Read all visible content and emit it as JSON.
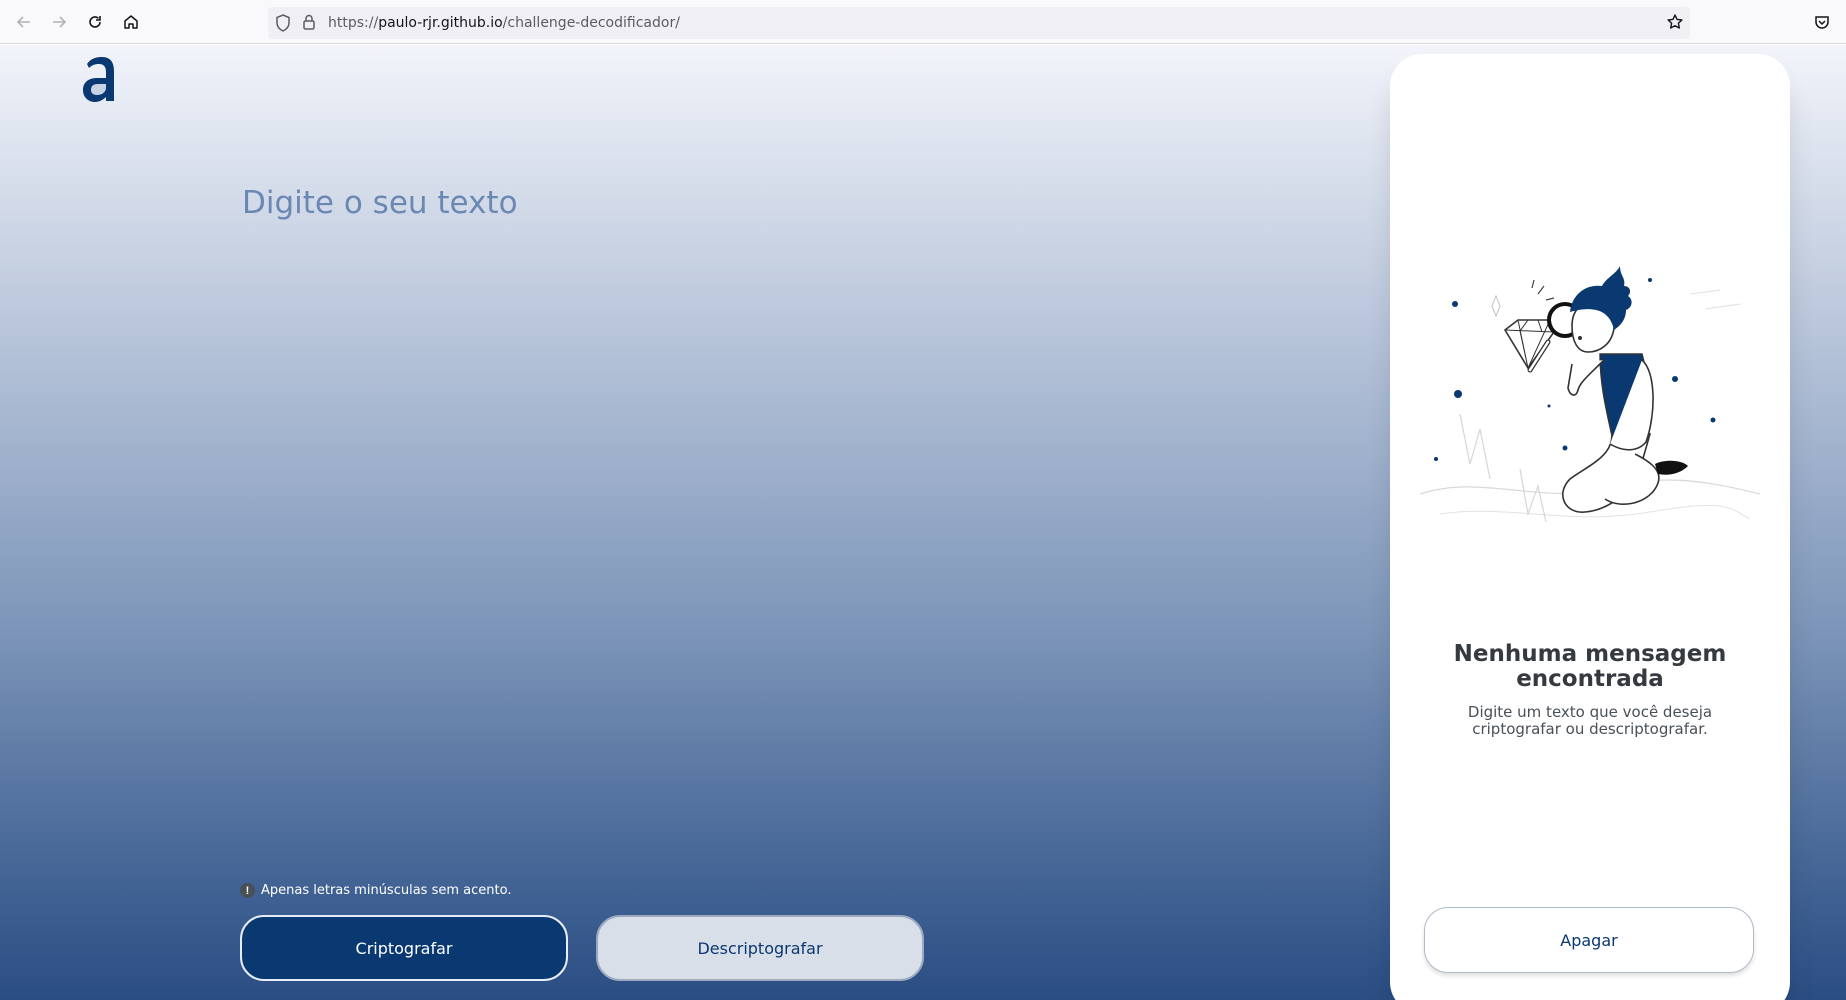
{
  "browser": {
    "url_prefix": "https://",
    "url_host": "paulo-rjr.github.io",
    "url_path": "/challenge-decodificador/",
    "icons": [
      "back-arrow-icon",
      "forward-arrow-icon",
      "reload-icon",
      "home-icon",
      "shield-icon",
      "lock-icon",
      "bookmark-star-icon",
      "pocket-icon"
    ]
  },
  "header": {
    "logo_icon": "alura-logo-icon"
  },
  "input": {
    "placeholder": "Digite o seu texto",
    "value": ""
  },
  "hint": {
    "icon": "info-icon",
    "glyph": "!",
    "text": "Apenas letras minúsculas sem acento."
  },
  "buttons": {
    "encrypt": "Criptografar",
    "decrypt": "Descriptografar"
  },
  "result": {
    "illustration": "person-with-magnifying-glass-illustration",
    "title": "Nenhuma mensagem encontrada",
    "description": "Digite um texto que você deseja criptografar ou descriptografar.",
    "clear_button": "Apagar"
  },
  "colors": {
    "primary": "#0a3871",
    "page_gradient_top": "#f2f4fa",
    "page_gradient_bottom": "#2a4d83",
    "secondary_button": "#d8dfe8",
    "panel_background": "#ffffff"
  }
}
